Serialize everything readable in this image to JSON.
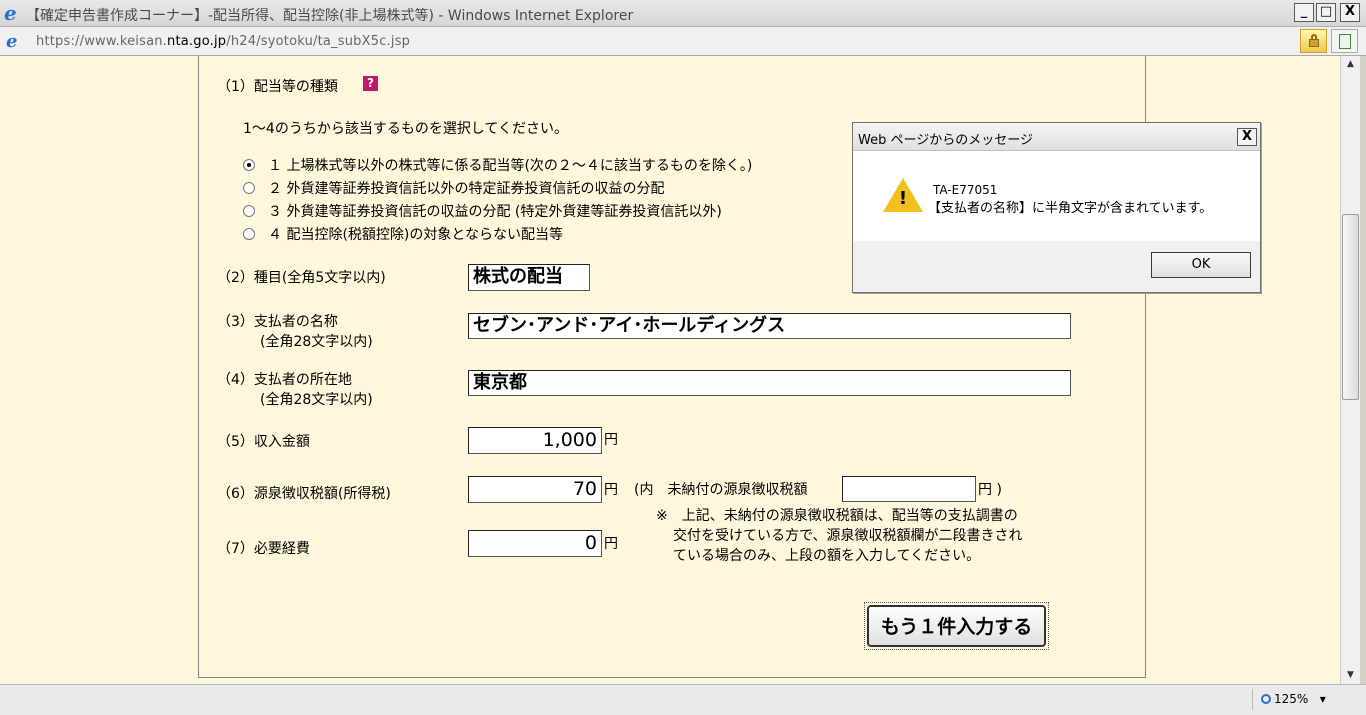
{
  "window": {
    "title": "【確定申告書作成コーナー】-配当所得、配当控除(非上場株式等) - Windows Internet Explorer",
    "ie_logo": "e",
    "minimize": "_",
    "maximize": "□",
    "close": "X"
  },
  "address": {
    "url_prefix": "https://www.keisan.",
    "url_domain": "nta.go.jp",
    "url_path": "/h24/syotoku/ta_subX5c.jsp",
    "icon": "ie-page-icon"
  },
  "form": {
    "section1_label": "（1）配当等の種類",
    "help": "?",
    "instruction": "1～4のうちから該当するものを選択してください。",
    "radios": [
      {
        "label": "１ 上場株式等以外の株式等に係る配当等(次の２～４に該当するものを除く。)",
        "checked": true
      },
      {
        "label": "２ 外貨建等証券投資信託以外の特定証券投資信託の収益の分配",
        "checked": false
      },
      {
        "label": "３ 外貨建等証券投資信託の収益の分配 (特定外貨建等証券投資信託以外)",
        "checked": false
      },
      {
        "label": "４ 配当控除(税額控除)の対象とならない配当等",
        "checked": false
      }
    ],
    "section2_label": "（2）種目(全角5文字以内)",
    "section2_value": "株式の配当",
    "section3_label": "（3）支払者の名称",
    "section3_sub": "(全角28文字以内)",
    "section3_value": "セブン･アンド･アイ･ホールディングス",
    "section4_label": "（4）支払者の所在地",
    "section4_sub": "(全角28文字以内)",
    "section4_value": "東京都",
    "section5_label": "（5）収入金額",
    "section5_value": "1,000",
    "section6_label": "（6）源泉徴収税額(所得税)",
    "section6_value": "70",
    "section6_paren_open": "(内　未納付の源泉徴収税額",
    "section6_unpaid_value": "",
    "section6_paren_close": "円 )",
    "section7_label": "（7）必要経費",
    "section7_value": "0",
    "yen": "円",
    "note_line1": "※　上記、未納付の源泉徴収税額は、配当等の支払調書の",
    "note_line2": "交付を受けている方で、源泉徴収税額欄が二段書きされ",
    "note_line3": "ている場合のみ、上段の額を入力してください。",
    "add_button": "もう１件入力する"
  },
  "status": {
    "zoom": "125%",
    "zoom_dropdown": "▾"
  },
  "dialog": {
    "title": "Web ページからのメッセージ",
    "close": "X",
    "warn_glyph": "!",
    "code": "TA-E77051",
    "message": "【支払者の名称】に半角文字が含まれています。",
    "ok": "OK"
  },
  "scrollbar": {
    "up": "▲",
    "down": "▼"
  }
}
